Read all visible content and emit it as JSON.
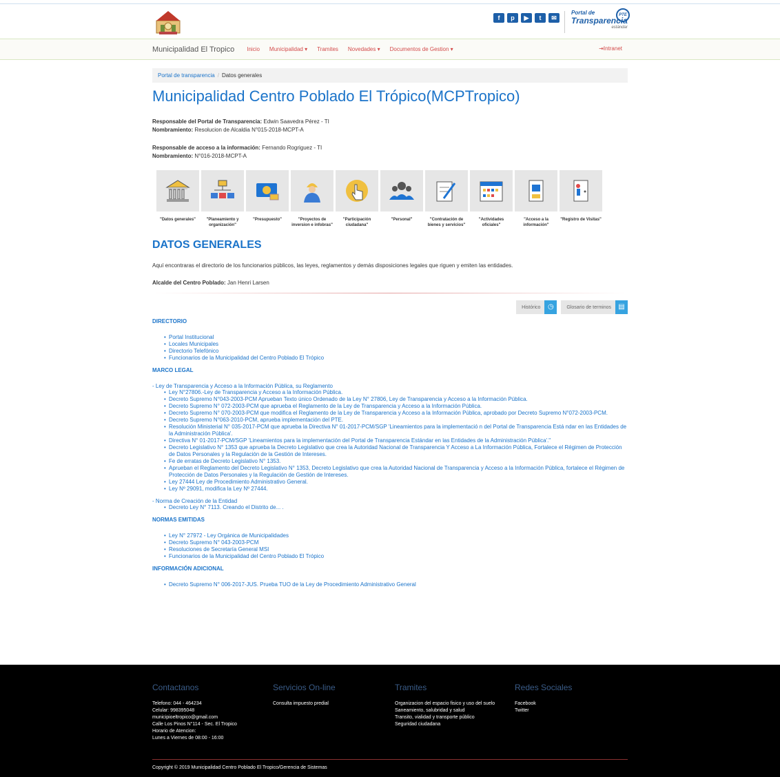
{
  "header": {
    "social": [
      "f",
      "p",
      "▶",
      "t",
      "✉"
    ],
    "pte": {
      "line1": "Portal de",
      "line2": "Transparencia",
      "line3": "estándar",
      "badge": "PTE"
    }
  },
  "nav": {
    "brand": "Municipalidad El Tropico",
    "items": [
      "Inicio",
      "Municipalidad ▾",
      "Tramites",
      "Novedades ▾",
      "Documentos de Gestion ▾"
    ],
    "intranet": "⇥Intranet"
  },
  "breadcrumb": {
    "home": "Portal de transparencia",
    "sep": "/",
    "current": "Datos generales"
  },
  "title": "Municipalidad Centro Poblado El Trópico(MCPTropico)",
  "responsables": {
    "r1_label": "Responsable del Portal de Transparencia:",
    "r1_value": " Edwin Saavedra Pérez - TI",
    "n1_label": "Nombramiento:",
    "n1_value": " Resolucion de Alcaldia N°015-2018-MCPT-A",
    "r2_label": "Responsable de acceso a la información:",
    "r2_value": " Fernando Rogriguez - TI",
    "n2_label": "Nombramiento:",
    "n2_value": " N°016-2018-MCPT-A"
  },
  "categories": [
    "\"Datos generales\"",
    "\"Planeamiento y organización\"",
    "\"Presupuesto\"",
    "\"Proyectos de inversion e infobras\"",
    "\"Participación ciudadana\"",
    "\"Personal\"",
    "\"Contratación de bienes y servicios\"",
    "\"Actividades oficiales\"",
    "\"Acceso a la información\"",
    "\"Registro de Visitas\""
  ],
  "section_title": "DATOS GENERALES",
  "intro": "Aquí encontraras el directorio de los funcionarios públicos, las leyes, reglamentos y demás disposiciones legales que riguen y emiten las entidades.",
  "alcalde": {
    "label": "Alcalde del Centro Poblado:",
    "value": " Jan Henri Larsen"
  },
  "tools": {
    "historico": "Histórico",
    "glosario": "Glosario de terminos"
  },
  "directorio": {
    "title": "DIRECTORIO",
    "items": [
      "Portal Institucional",
      "Locales Municipales",
      "Directorio Telefónico",
      "Funcionarios de la Municipalidad del Centro Poblado El Trópico"
    ]
  },
  "marco": {
    "title": "MARCO LEGAL",
    "g1": "- Ley de Transparencia y Acceso a la Información Pública, su Reglamento",
    "g1_items": [
      "Ley N°27806.-Ley de Transparencia y Acceso a la Información Pública.",
      "Decreto Supremo N°043-2003-PCM Aprueban Texto único Ordenado de la Ley N° 27806, Ley de Transparencia y Acceso a la Información Pública.",
      "Decreto Supremo N° 072-2003-PCM que aprueba el Reglamento de la Ley de Transparencia y Acceso a la Información Pública.",
      "Decreto Supremo N° 070-2003-PCM que modifica el Reglamento de la Ley de Transparencia y Acceso a la Información Pública, aprobado por Decreto Supremo N°072-2003-PCM.",
      "Decreto Supremo N°063-2010-PCM, aprueba implementación del PTE.",
      "Resolución Ministerial N° 035-2017-PCM que aprueba la Directiva N° 01-2017-PCM/SGP 'Lineamientos para la implementació n del Portal de Transparencia Está ndar en las Entidades de la Administración Pública'.",
      "Directiva N° 01-2017-PCM/SGP 'Lineamientos para la implementación del Portal de Transparencia Estándar en las Entidades de la Administración Pública'.\"",
      "Decreto Legislativo N° 1353 que aprueba la Decreto Legislativo que crea la Autoridad Nacional de Transparencia Y Acceso a La Información Pública, Fortalece el Régimen de Protección de Datos Personales y la Regulación de la Gestión de Intereses.",
      "Fe de erratas de Decreto Legislativo N° 1353.",
      "Aprueban el Reglamento del Decreto Legislativo N° 1353, Decreto Legislativo que crea la Autoridad Nacional de Transparencia y Acceso a la Información Pública, fortalece el Régimen de Protección de Datos Personales y la Regulación de Gestión de Intereses.",
      "Ley 27444 Ley de Procedimiento Administrativo General.",
      "Ley Nº 29091, modifica la Ley Nº 27444."
    ],
    "g2": "- Norma de Creación de la Entidad",
    "g2_items": [
      "Decreto Ley N° 7113. Creando el Distrito de... ."
    ]
  },
  "normas": {
    "title": "NORMAS EMITIDAS",
    "items": [
      "Ley N° 27972 - Ley Orgánica de Municipalidades",
      "Decreto Supremo N° 043-2003-PCM",
      "Resoluciones de Secretaría General MSI",
      "Funcionarios de la Municipalidad del Centro Poblado El Trópico"
    ]
  },
  "adicional": {
    "title": "INFORMACIÓN ADICIONAL",
    "items": [
      "Decreto Supremo N° 006-2017-JUS. Prueba TUO de la Ley de Procedimiento Administrativo General"
    ]
  },
  "footer": {
    "c1": {
      "title": "Contactanos",
      "lines": [
        "Telefono: 044 - 464234",
        "Celular: 998395048",
        "municipioeltropico@gmail.com",
        "Calle Los Pinos N°114 - Sec. El Tropico",
        "Horario de Atencion:",
        "Lunes a Viernes de 08:00 - 16:00"
      ]
    },
    "c2": {
      "title": "Servicios On-line",
      "lines": [
        "Consulta impuesto predial"
      ]
    },
    "c3": {
      "title": "Tramites",
      "lines": [
        "Organizacion del espacio fisico y uso del suelo",
        "Saneamiento, salubridad y salud",
        "Transito, vialidad y transporte público",
        "Seguridad ciudadana"
      ]
    },
    "c4": {
      "title": "Redes Sociales",
      "lines": [
        "Facebook",
        "Twitter"
      ]
    },
    "copyright": "Copyright © 2019 Municipalidad Centro Poblado El Tropico/Gerencia de Sistemas"
  }
}
